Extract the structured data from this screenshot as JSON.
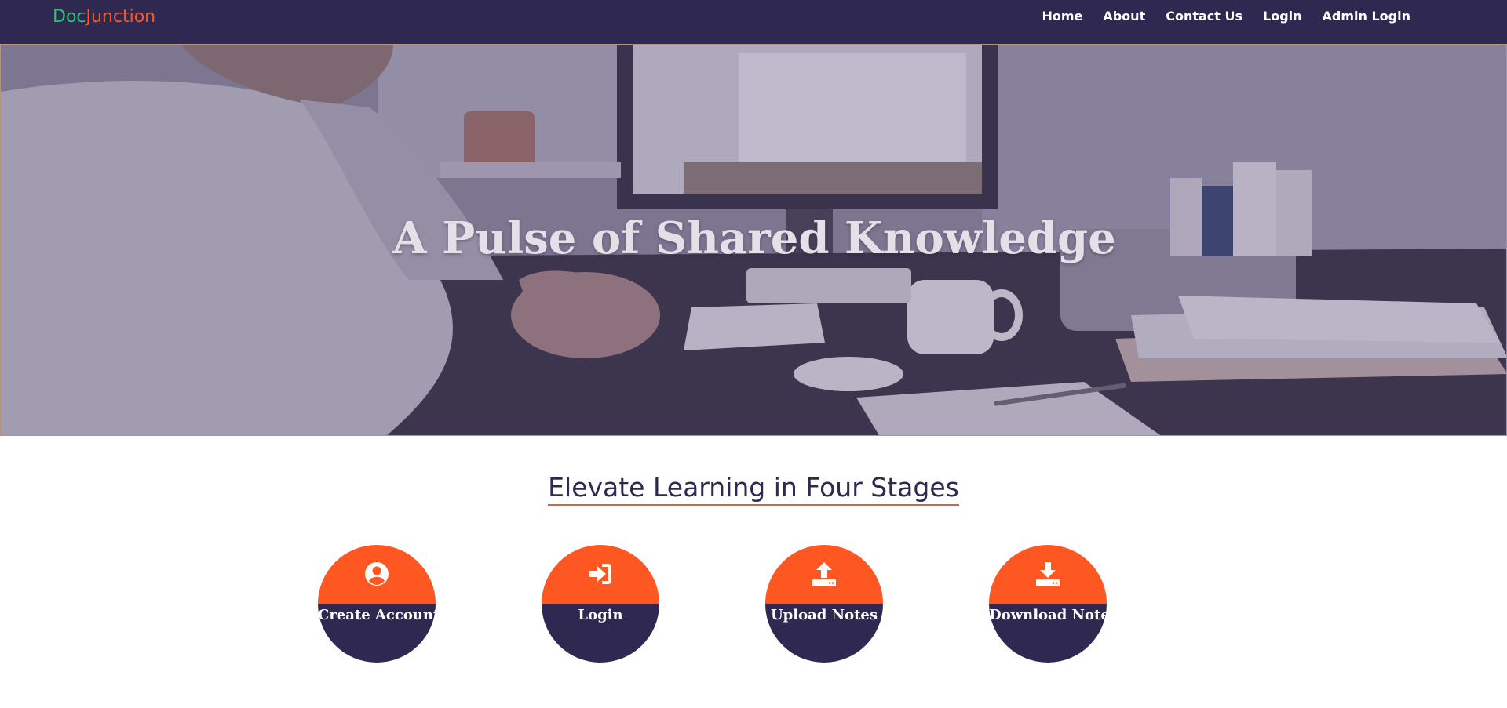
{
  "brand": {
    "part1": "Doc",
    "part2": "Junction"
  },
  "nav": {
    "items": [
      "Home",
      "About",
      "Contact Us",
      "Login",
      "Admin Login"
    ]
  },
  "hero": {
    "title": "A Pulse of Shared Knowledge"
  },
  "section": {
    "title": "Elevate Learning in Four Stages"
  },
  "stages": [
    {
      "label": "Create Account",
      "icon": "user-circle-icon"
    },
    {
      "label": "Login",
      "icon": "sign-in-icon"
    },
    {
      "label": "Upload Notes",
      "icon": "upload-icon"
    },
    {
      "label": "Download Notes",
      "icon": "download-icon"
    }
  ],
  "colors": {
    "navbar": "#2f2850",
    "accent": "#ff5722",
    "brand_green": "#2fbf71"
  }
}
